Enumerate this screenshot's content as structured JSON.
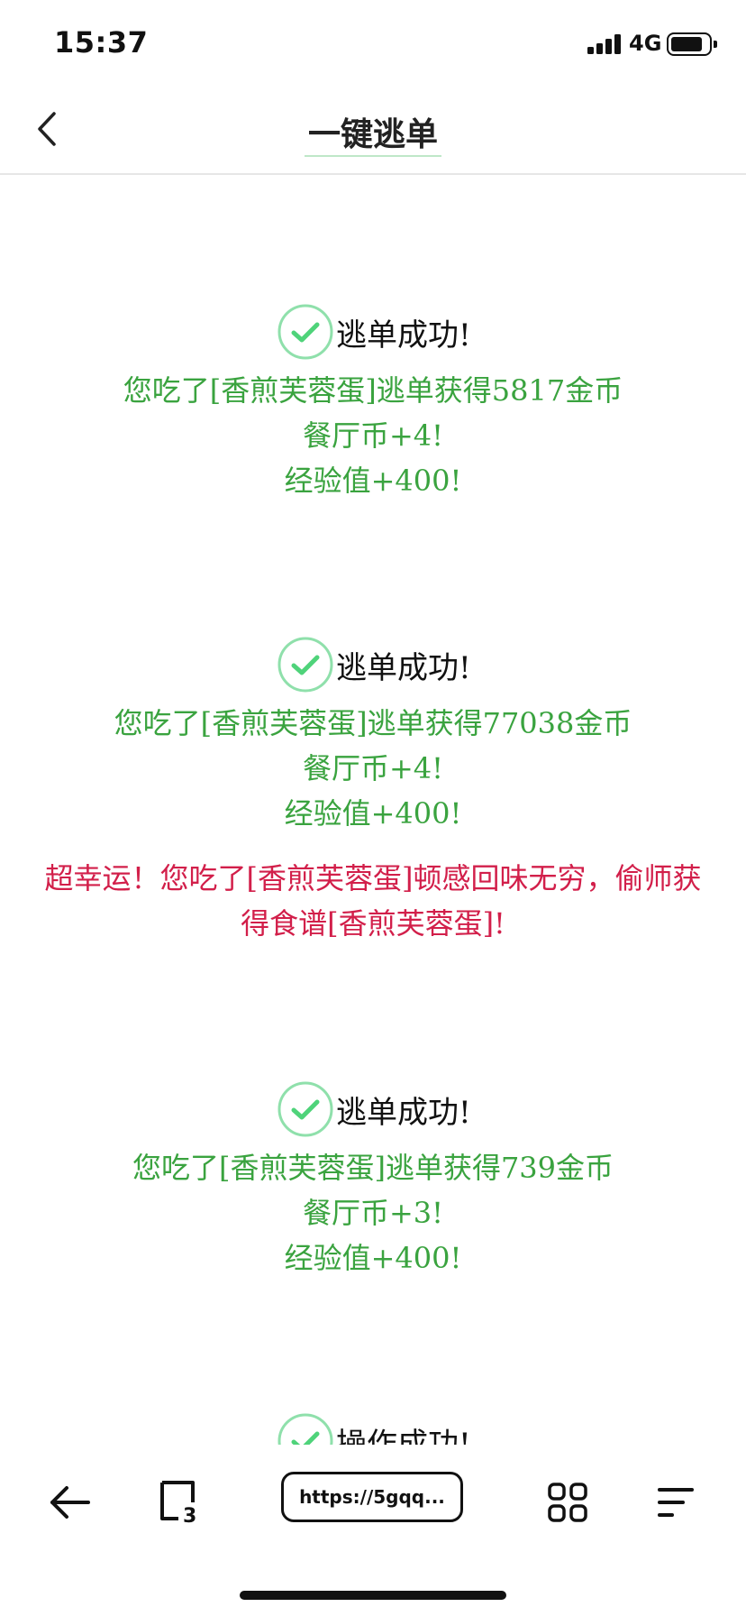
{
  "status_bar": {
    "time": "15:37",
    "network": "4G"
  },
  "header": {
    "title": "一键逃单"
  },
  "results": [
    {
      "title": "逃单成功!",
      "lines": [
        "您吃了[香煎芙蓉蛋]逃单获得5817金币",
        "餐厅币+4!",
        "经验值+400!"
      ]
    },
    {
      "title": "逃单成功!",
      "lines": [
        "您吃了[香煎芙蓉蛋]逃单获得77038金币",
        "餐厅币+4!",
        "经验值+400!"
      ],
      "bonus": "超幸运！您吃了[香煎芙蓉蛋]顿感回味无穷，偷师获得食谱[香煎芙蓉蛋]!"
    },
    {
      "title": "逃单成功!",
      "lines": [
        "您吃了[香煎芙蓉蛋]逃单获得739金币",
        "餐厅币+3!",
        "经验值+400!"
      ]
    },
    {
      "title": "操作成功!"
    }
  ],
  "toolbar": {
    "url": "https://5gqq...",
    "tabs_count": "3"
  },
  "colors": {
    "success_text": "#3aa33f",
    "bonus_text": "#d21f4a",
    "check_icon": "#4fd37a"
  },
  "icons": [
    "back-chevron-icon",
    "check-circle-icon",
    "back-arrow-icon",
    "tabs-icon",
    "grid-icon",
    "menu-icon"
  ]
}
